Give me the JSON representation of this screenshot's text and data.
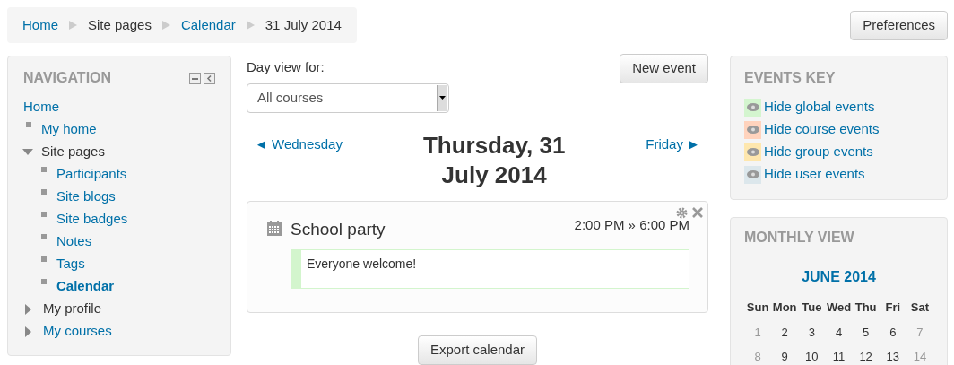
{
  "breadcrumb": [
    {
      "label": "Home",
      "kind": "link"
    },
    {
      "label": "Site pages",
      "kind": "text"
    },
    {
      "label": "Calendar",
      "kind": "link"
    },
    {
      "label": "31 July 2014",
      "kind": "text"
    }
  ],
  "preferences_button": "Preferences",
  "navigation": {
    "title": "NAVIGATION",
    "items": [
      {
        "label": "Home",
        "kind": "root",
        "link": true,
        "selected": false
      },
      {
        "label": "My home",
        "kind": "leaf",
        "link": true,
        "selected": false
      },
      {
        "label": "Site pages",
        "kind": "branch",
        "link": false,
        "expanded": true,
        "selected": false,
        "children": [
          {
            "label": "Participants",
            "kind": "leaf",
            "link": true,
            "selected": false
          },
          {
            "label": "Site blogs",
            "kind": "leaf",
            "link": true,
            "selected": false
          },
          {
            "label": "Site badges",
            "kind": "leaf",
            "link": true,
            "selected": false
          },
          {
            "label": "Notes",
            "kind": "leaf",
            "link": true,
            "selected": false
          },
          {
            "label": "Tags",
            "kind": "leaf",
            "link": true,
            "selected": false
          },
          {
            "label": "Calendar",
            "kind": "leaf",
            "link": true,
            "selected": true
          }
        ]
      },
      {
        "label": "My profile",
        "kind": "branch",
        "link": false,
        "expanded": false,
        "selected": false
      },
      {
        "label": "My courses",
        "kind": "branch",
        "link": true,
        "expanded": false,
        "selected": false
      }
    ]
  },
  "day_view": {
    "label": "Day view for:",
    "select": "All courses",
    "new_event_button": "New event",
    "prev": "◄ Wednesday",
    "next": "Friday ►",
    "date": "Thursday, 31 July 2014",
    "event": {
      "title": "School party",
      "time": "2:00 PM » 6:00 PM",
      "description": "Everyone welcome!",
      "color": "#d3f5cd"
    },
    "export_button": "Export calendar"
  },
  "events_key": {
    "title": "EVENTS KEY",
    "items": [
      {
        "label": "Hide global events",
        "color": "#d4f5cf"
      },
      {
        "label": "Hide course events",
        "color": "#ffd3bd"
      },
      {
        "label": "Hide group events",
        "color": "#fee7ae"
      },
      {
        "label": "Hide user events",
        "color": "#dce7ec"
      }
    ]
  },
  "monthly_view": {
    "title": "MONTHLY VIEW",
    "month": "JUNE 2014",
    "weekdays": [
      "Sun",
      "Mon",
      "Tue",
      "Wed",
      "Thu",
      "Fri",
      "Sat"
    ],
    "weeks": [
      [
        {
          "day": "1",
          "weekend": true
        },
        {
          "day": "2",
          "weekend": false
        },
        {
          "day": "3",
          "weekend": false
        },
        {
          "day": "4",
          "weekend": false
        },
        {
          "day": "5",
          "weekend": false
        },
        {
          "day": "6",
          "weekend": false
        },
        {
          "day": "7",
          "weekend": true
        }
      ],
      [
        {
          "day": "8",
          "weekend": true
        },
        {
          "day": "9",
          "weekend": false
        },
        {
          "day": "10",
          "weekend": false
        },
        {
          "day": "11",
          "weekend": false
        },
        {
          "day": "12",
          "weekend": false
        },
        {
          "day": "13",
          "weekend": false
        },
        {
          "day": "14",
          "weekend": true
        }
      ]
    ]
  }
}
